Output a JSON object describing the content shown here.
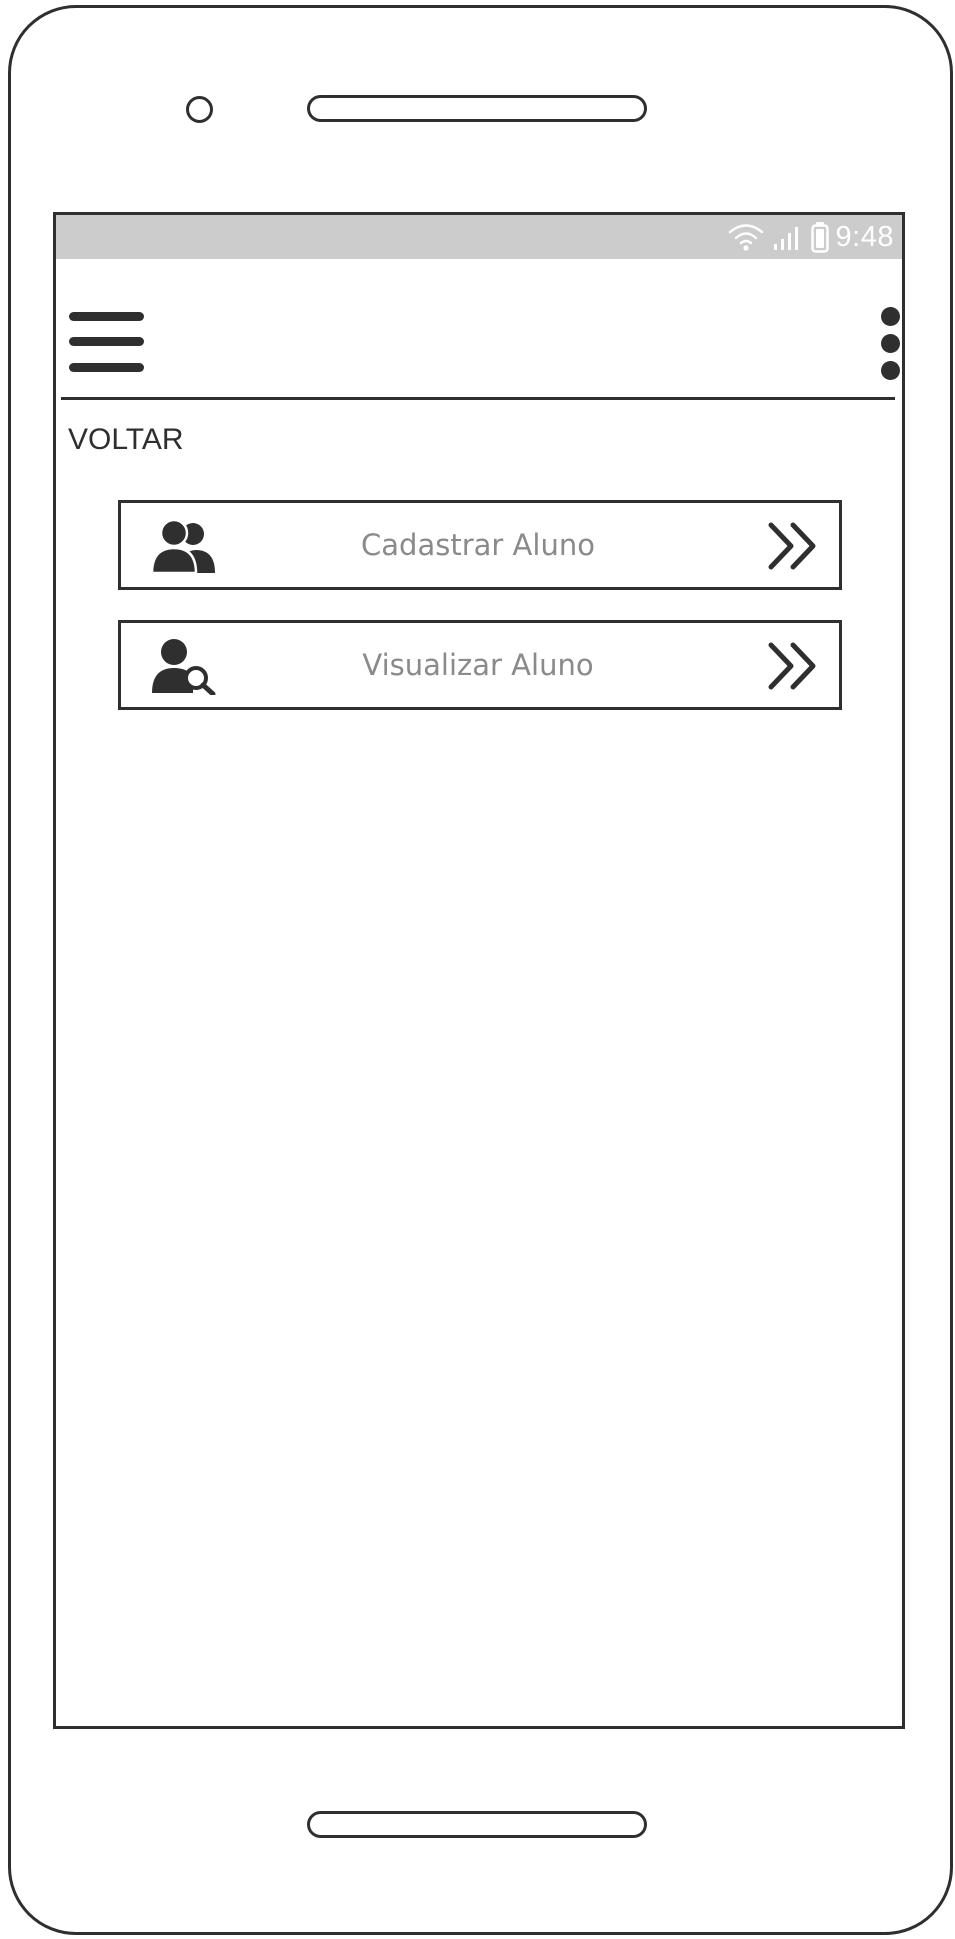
{
  "status_bar": {
    "time": "9:48",
    "icons": [
      "wifi-icon",
      "signal-icon",
      "battery-icon"
    ],
    "background": "#cccccc"
  },
  "app_bar": {
    "menu_icon": "hamburger-menu-icon",
    "overflow_icon": "more-vert-icon"
  },
  "back_link": "VOLTAR",
  "menu": {
    "items": [
      {
        "label": "Cadastrar Aluno",
        "icon": "users-icon",
        "arrow_icon": "double-chevron-right-icon"
      },
      {
        "label": "Visualizar Aluno",
        "icon": "user-search-icon",
        "arrow_icon": "double-chevron-right-icon"
      }
    ]
  },
  "colors": {
    "ink": "#2f2f2f",
    "button_text": "#8a8a8a",
    "status_bar": "#cccccc"
  }
}
